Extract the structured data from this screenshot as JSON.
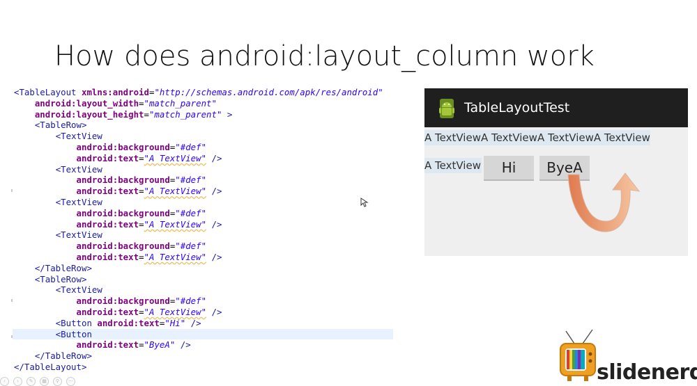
{
  "slide": {
    "title": "How does android:layout_column work"
  },
  "code": {
    "line1": {
      "t1": "<TableLayout ",
      "a1": "xmlns:android",
      "v1": "\"http://schemas.android.com/apk/res/android\""
    },
    "line2": {
      "a1": "android:layout_width",
      "v1": "\"match_parent\""
    },
    "line3": {
      "a1": "android:layout_height",
      "v1": "\"match_parent\"",
      "t2": " >"
    },
    "line4": {
      "t1": "<TableRow>"
    },
    "tv_open": "<TextView",
    "bg_attr": "android:background",
    "bg_val": "\"#def\"",
    "text_attr": "android:text",
    "text_val": "\"A TextView\"",
    "self_close": " />",
    "row_close": "</TableRow>",
    "button_hi": {
      "t1": "<Button ",
      "a1": "android:text",
      "v1": "\"Hi\"",
      "t2": " />"
    },
    "button_open": "<Button",
    "bye_val": "\"ByeA\"",
    "table_close": "</TableLayout>"
  },
  "app": {
    "title": "TableLayoutTest",
    "row1": [
      "A TextView",
      "A TextView",
      "A TextView",
      "A TextView"
    ],
    "row2_text": "A TextView",
    "button_hi": "Hi",
    "button_bye": "ByeA",
    "colors": {
      "action_bar": "#1f1f1f",
      "textview_bg": "#dde8f1",
      "button": "#d6d6d6",
      "arrow": "#f0a070"
    }
  },
  "logo": {
    "text": "slidenerd"
  },
  "toolbar": {
    "icons": [
      "prev-icon",
      "next-icon",
      "pen-icon",
      "slides-icon",
      "zoom-icon",
      "more-icon"
    ]
  }
}
